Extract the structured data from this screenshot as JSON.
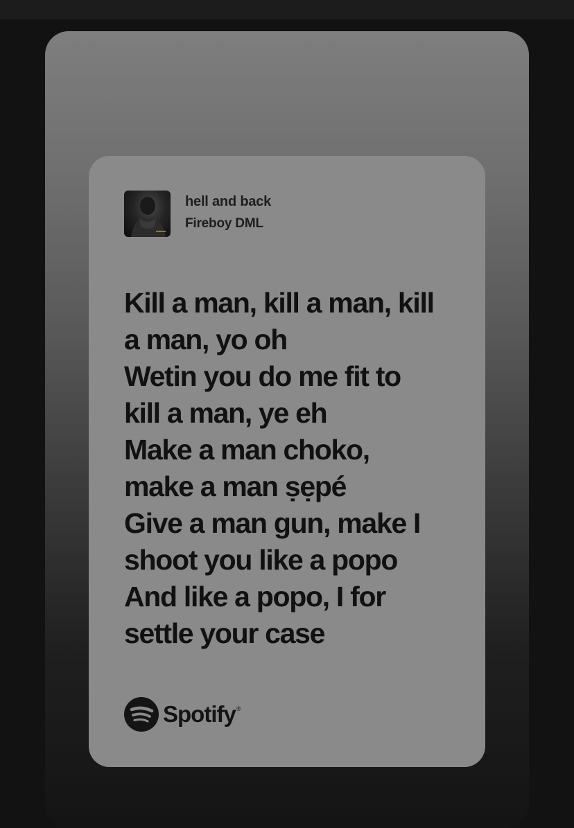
{
  "share_card": {
    "track": {
      "title": "hell and back",
      "artist": "Fireboy DML",
      "album_art_icon": "album-cover-portrait"
    },
    "lyrics": [
      "Kill a man, kill a man, kill",
      "a man, yo oh",
      "Wetin you do me fit to",
      "kill a man, ye eh",
      "Make a man choko,",
      "make a man ṣẹpé",
      "Give a man gun, make I",
      "shoot you like a popo",
      "And like a popo, I for",
      "settle your case"
    ],
    "brand": {
      "name": "Spotify",
      "trademark": "®",
      "icon": "spotify-icon"
    }
  },
  "colors": {
    "page_background": "#121212",
    "card_background": "#8a8a8a",
    "text": "#111111"
  }
}
